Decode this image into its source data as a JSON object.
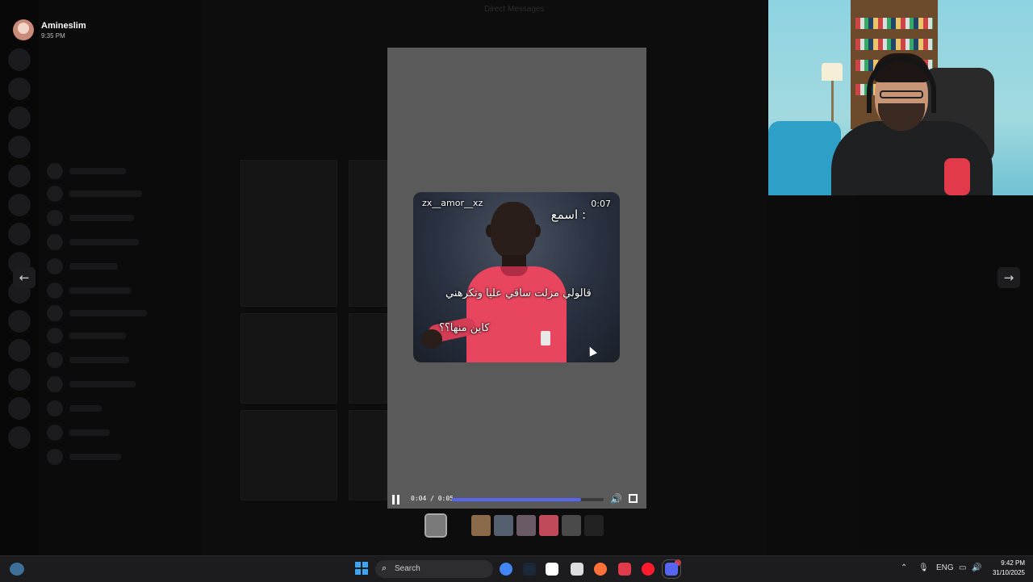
{
  "background": {
    "top_hint": "Direct Messages"
  },
  "user": {
    "name": "Amineslim",
    "time": "9:35 PM"
  },
  "video": {
    "username": "zx__amor__xz",
    "counter": "0:07",
    "caption_top": "اسمع :",
    "caption_mid": "قالولي مزلت ساقي عليا وتكرهني",
    "caption_bottom": "كاين منها؟؟"
  },
  "player": {
    "time": "0:04 / 0:05",
    "progress": 0.85,
    "accent": "#5865f2"
  },
  "navigation": {
    "prev_icon": "arrow-left-icon",
    "next_icon": "arrow-right-icon"
  },
  "thumbnails": [
    {
      "color": "#7a7a7a",
      "active": true
    },
    {
      "color": "#8a6a4a",
      "active": false
    },
    {
      "color": "#55606e",
      "active": false
    },
    {
      "color": "#6a5a66",
      "active": false
    },
    {
      "color": "#c04a5a",
      "active": false
    },
    {
      "color": "#4a4a4a",
      "active": false
    },
    {
      "color": "#222222",
      "active": false
    }
  ],
  "taskbar": {
    "search_placeholder": "Search",
    "language": "ENG",
    "time": "9:42 PM",
    "date": "31/10/2025",
    "apps": [
      {
        "icon": "chrome-icon",
        "color": "#4285f4"
      },
      {
        "icon": "steam-icon",
        "color": "#1b2838"
      },
      {
        "icon": "capcut-icon",
        "color": "#ffffff"
      },
      {
        "icon": "chatgpt-icon",
        "color": "#dddddd"
      },
      {
        "icon": "firefox-icon",
        "color": "#ff7139"
      },
      {
        "icon": "settings-icon",
        "color": "#e23a4a"
      },
      {
        "icon": "opera-icon",
        "color": "#ff1b2d"
      },
      {
        "icon": "discord-icon",
        "color": "#5865f2"
      }
    ]
  }
}
